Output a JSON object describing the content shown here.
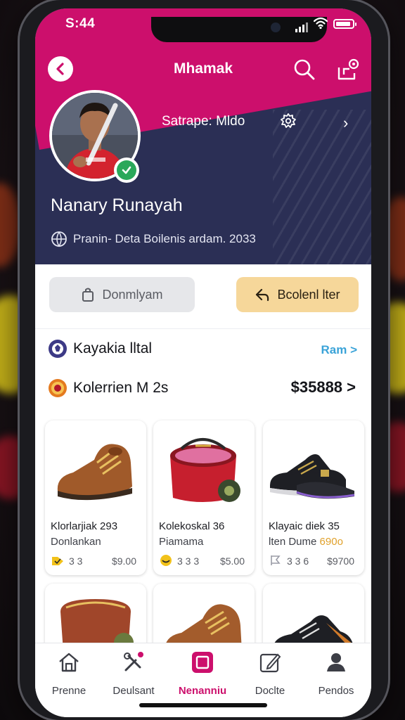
{
  "status": {
    "time": "S:44"
  },
  "header": {
    "title": "Mhamak"
  },
  "profile": {
    "subline": "Satrape: Mldo",
    "name": "Nanary Runayah",
    "meta": "Pranin- Deta Boilenis ardam. 2033"
  },
  "actions": {
    "secondary_label": "Donmlyam",
    "primary_label": "Bcolenl lter"
  },
  "rows": {
    "row1_label": "Kayakia lltal",
    "row1_link": "Ram >",
    "row2_label": "Kolerrien M 2s",
    "row2_value": "$35888 >"
  },
  "products": [
    {
      "title": "Klorlarjiak  293",
      "sub": "Donlankan",
      "sub_accent": "",
      "count": "3 3",
      "price": "$9.00",
      "icon": "tag-icon",
      "icon_color": "#f2c21a"
    },
    {
      "title": "Kolekoskal  36",
      "sub": "Piamama",
      "sub_accent": "",
      "count": "3 3 3",
      "price": "$5.00",
      "icon": "badge-icon",
      "icon_color": "#f2c21a"
    },
    {
      "title": "Klayaic diek  35",
      "sub": "lten Dume ",
      "sub_accent": "690o",
      "count": "3 3 6",
      "price": "$9700",
      "icon": "flag-icon",
      "icon_color": "#9a9ca6"
    }
  ],
  "tabs": [
    {
      "label": "Prenne",
      "icon": "home-icon"
    },
    {
      "label": "Deulsant",
      "icon": "tools-icon"
    },
    {
      "label": "Nenanniu",
      "icon": "square-icon"
    },
    {
      "label": "Doclte",
      "icon": "edit-icon"
    },
    {
      "label": "Pendos",
      "icon": "user-icon"
    }
  ],
  "colors": {
    "brand": "#cc0f6c",
    "navy": "#2b2f55",
    "accent_gold": "#f6d79a",
    "link": "#3aa3d8"
  }
}
